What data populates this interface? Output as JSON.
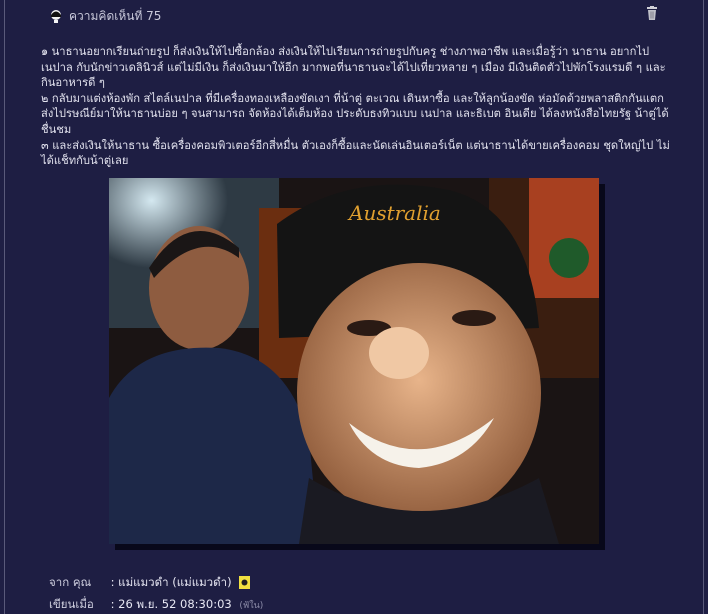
{
  "comment": {
    "title": "ความคิดเห็นที่ 75",
    "paragraphs": [
      "๑ นาธานอยากเรียนถ่ายรูป ก็ส่งเงินให้ไปซื้อกล้อง ส่งเงินให้ไปเรียนการถ่ายรูปกับครู ช่างภาพอาชีพ และเมื่อรู้ว่า นาธาน อยากไปเนปาล กับนักข่าวเดลินิวส์ แต่ไม่มีเงิน ก็ส่งเงินมาให้อีก มากพอที่นาธานจะได้ไปเที่ยวหลาย ๆ เมือง มีเงินติดตัวไปพักโรงแรมดี ๆ และกินอาหารดี ๆ",
      "๒ กลับมาแต่งห้องพัก สไตล์เนปาล ที่มีเครื่องทองเหลืองขัดเงา ที่น้าตู่ ตะเวณ เดินหาซื้อ และให้ลูกน้องขัด ห่อมัดด้วยพลาสติกกันแตก ส่งไปรษณีย์มาให้นาธานบ่อย ๆ จนสามารถ จัดห้องได้เต็มห้อง ประดับธงทิวแบบ เนปาล และธิเบต อินเดีย ได้ลงหนังสือไทยรัฐ น้าตู่ได้ชื่นชม",
      "๓ และส่งเงินให้นาธาน ซื้อเครื่องคอมพิวเตอร์อีกสี่หมื่น ตัวเองก็ซื้อและนัดเล่นอินเตอร์เน็ต แต่นาธานได้ขายเครื่องคอม ชุดใหญ่ไป ไม่ได้แช็ทกับน้าตู่เลย"
    ]
  },
  "meta": {
    "from_label": "จาก คุณ",
    "from_value": ": แม่แมวดำ (แม่แมวดำ)",
    "posted_label": "เขียนเมื่อ",
    "posted_value": ": 26 พ.ย. 52 08:30:03",
    "ip_note": "(ฟัใน)"
  },
  "photo": {
    "cap_text": "Australia"
  },
  "icons": {
    "header": "commenter-avatar-icon",
    "delete": "trash-icon",
    "badge": "member-badge-icon"
  },
  "colors": {
    "background": "#1e1e43",
    "text": "#e2e2ee"
  }
}
